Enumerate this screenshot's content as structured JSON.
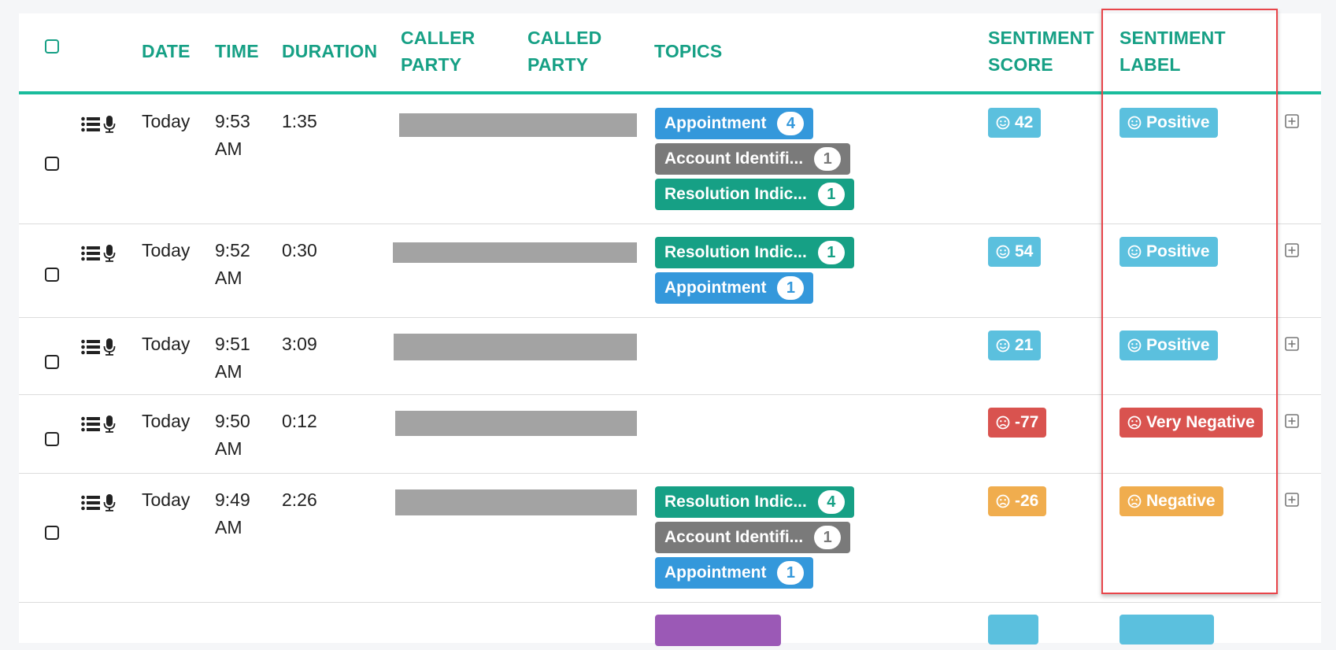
{
  "table": {
    "headers": {
      "select_all": "",
      "date": "DATE",
      "time": "TIME",
      "duration": "DURATION",
      "caller_party": [
        "CALLER",
        "PARTY"
      ],
      "called_party": [
        "CALLED",
        "PARTY"
      ],
      "topics": "TOPICS",
      "sentiment_score": [
        "SENTIMENT",
        "SCORE"
      ],
      "sentiment_label": [
        "SENTIMENT",
        "LABEL"
      ]
    },
    "rows": [
      {
        "date": "Today",
        "time": [
          "9:53",
          "AM"
        ],
        "duration": "1:35",
        "topics": [
          {
            "label": "Appointment",
            "count": "4",
            "color": "#3498db"
          },
          {
            "label": "Account Identifi...",
            "count": "1",
            "color": "#7a7a7a"
          },
          {
            "label": "Resolution Indic...",
            "count": "1",
            "color": "#16a085"
          }
        ],
        "score": "42",
        "score_face": "smile",
        "score_color": "#5bc0de",
        "label": "Positive",
        "label_face": "smile",
        "label_color": "#5bc0de"
      },
      {
        "date": "Today",
        "time": [
          "9:52",
          "AM"
        ],
        "duration": "0:30",
        "topics": [
          {
            "label": "Resolution Indic...",
            "count": "1",
            "color": "#16a085"
          },
          {
            "label": "Appointment",
            "count": "1",
            "color": "#3498db"
          }
        ],
        "score": "54",
        "score_face": "smile",
        "score_color": "#5bc0de",
        "label": "Positive",
        "label_face": "smile",
        "label_color": "#5bc0de"
      },
      {
        "date": "Today",
        "time": [
          "9:51",
          "AM"
        ],
        "duration": "3:09",
        "topics": [],
        "score": "21",
        "score_face": "smile",
        "score_color": "#5bc0de",
        "label": "Positive",
        "label_face": "smile",
        "label_color": "#5bc0de"
      },
      {
        "date": "Today",
        "time": [
          "9:50",
          "AM"
        ],
        "duration": "0:12",
        "topics": [],
        "score": "-77",
        "score_face": "frown",
        "score_color": "#d9534f",
        "label": "Very Negative",
        "label_face": "frown",
        "label_color": "#d9534f"
      },
      {
        "date": "Today",
        "time": [
          "9:49",
          "AM"
        ],
        "duration": "2:26",
        "topics": [
          {
            "label": "Resolution Indic...",
            "count": "4",
            "color": "#16a085"
          },
          {
            "label": "Account Identifi...",
            "count": "1",
            "color": "#7a7a7a"
          },
          {
            "label": "Appointment",
            "count": "1",
            "color": "#3498db"
          }
        ],
        "score": "-26",
        "score_face": "frown",
        "score_color": "#f0ad4e",
        "label": "Negative",
        "label_face": "frown",
        "label_color": "#f0ad4e"
      }
    ],
    "partial_row": {
      "topic_color": "#9b59b6",
      "score_color": "#5bc0de",
      "label_color": "#5bc0de"
    }
  },
  "icons": {
    "row_actions": [
      "list-icon",
      "microphone-icon"
    ],
    "expand": "plus-square-icon"
  },
  "colors": {
    "accent": "#16a085",
    "header_rule": "#1abc9c",
    "highlight_box": "#e8454a"
  }
}
